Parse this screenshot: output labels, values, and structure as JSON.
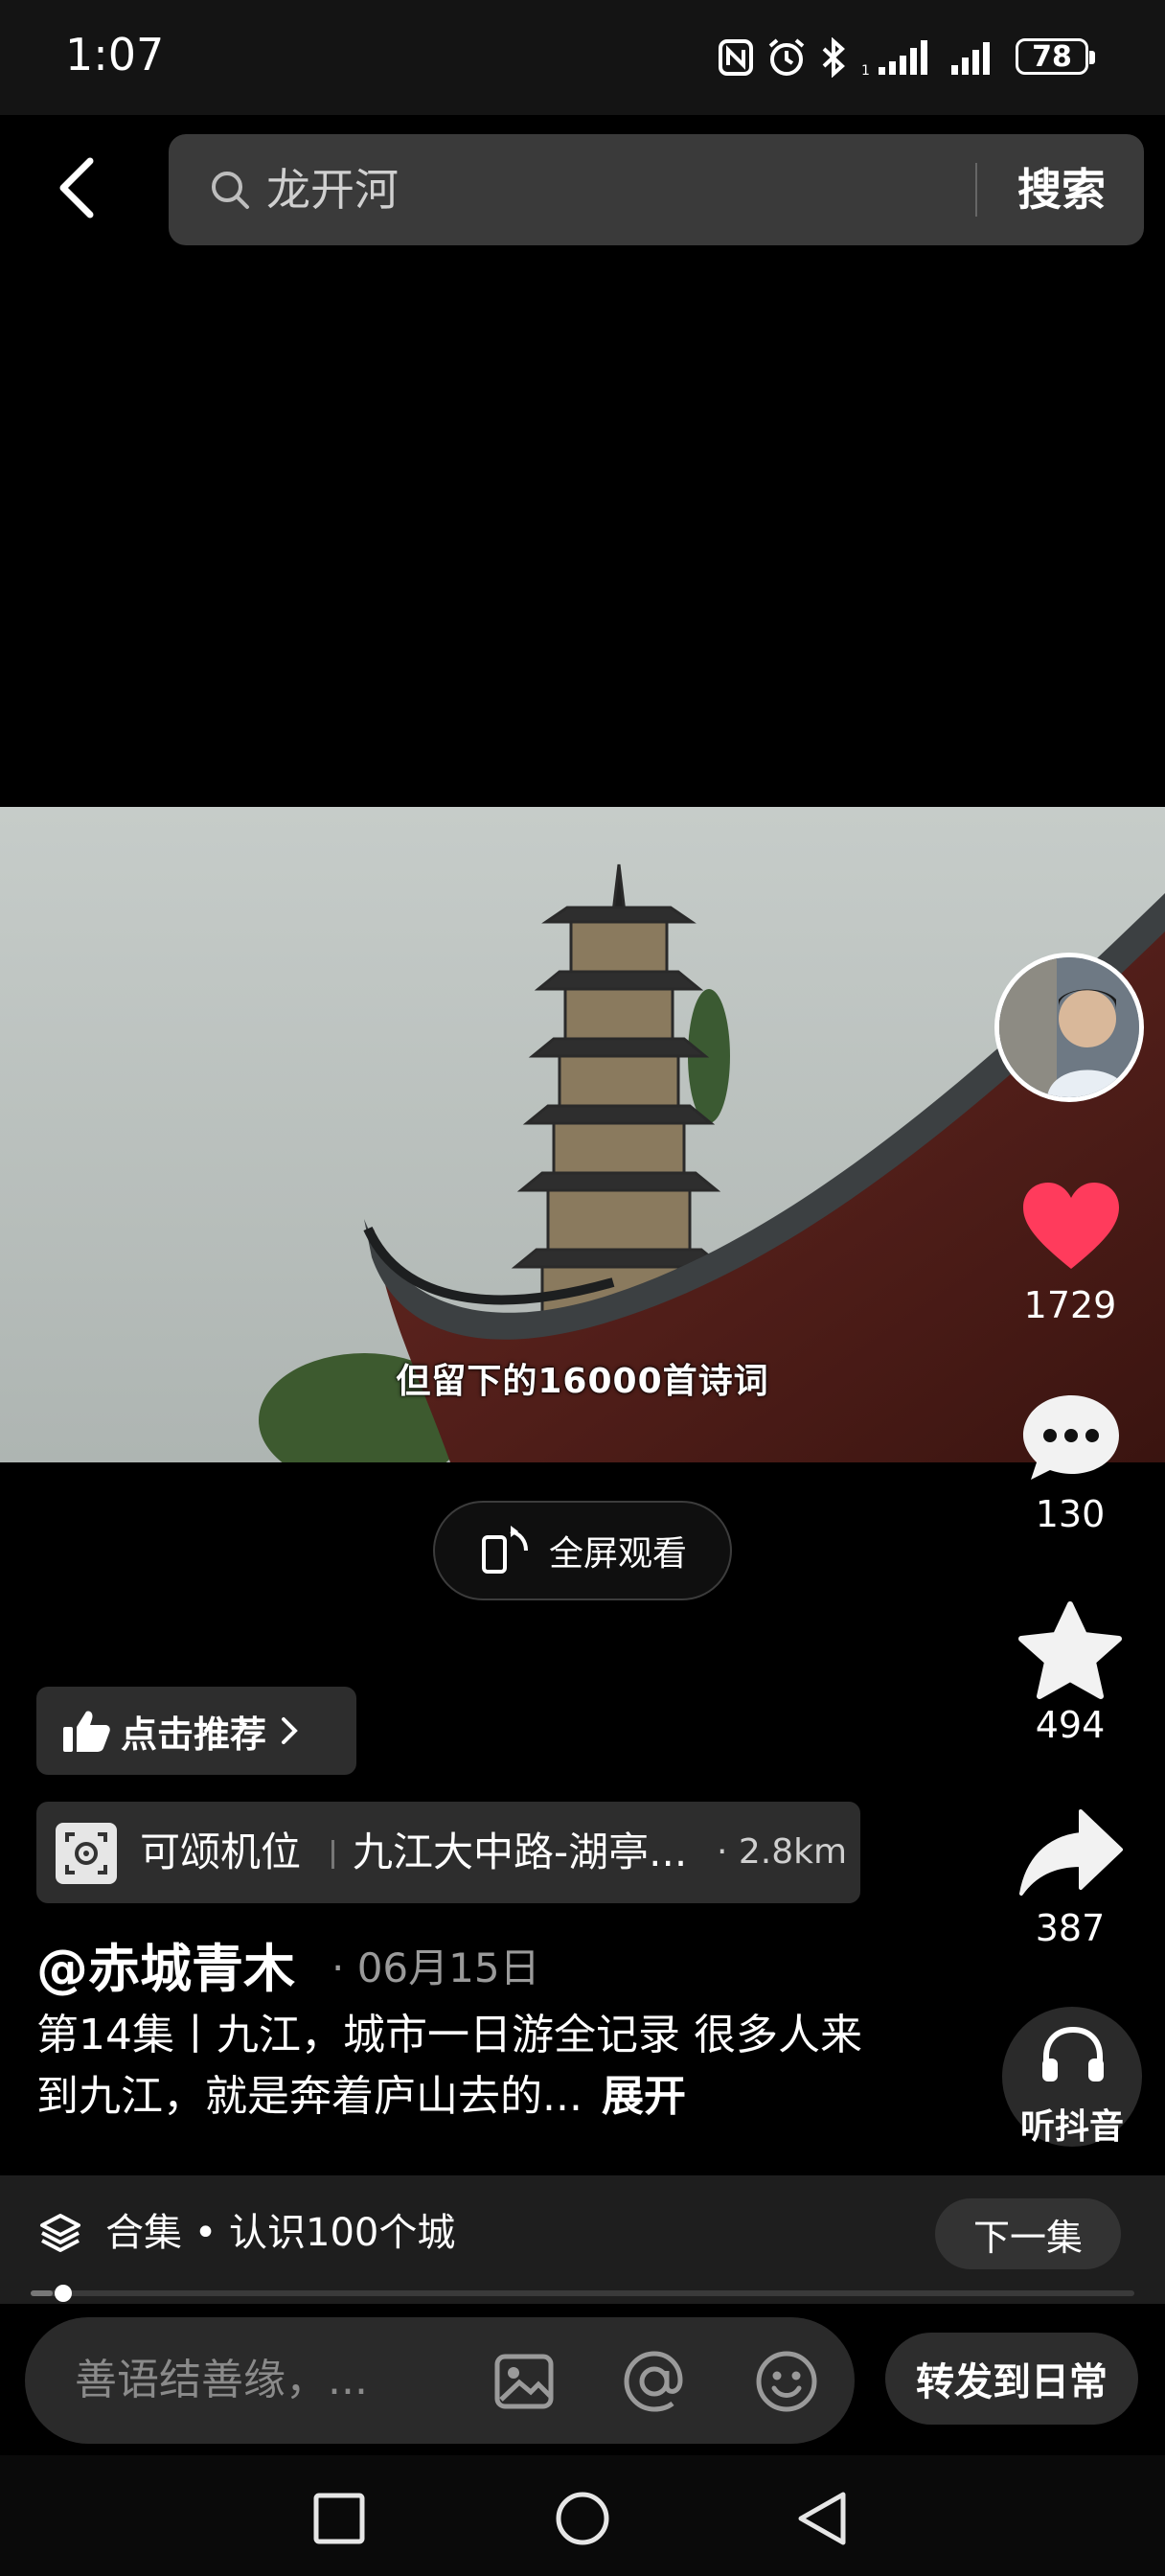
{
  "status_bar": {
    "time": "1:07",
    "battery": "78",
    "icons": [
      "nfc-icon",
      "alarm-icon",
      "bluetooth-icon",
      "signal-icon",
      "signal-icon",
      "battery-icon"
    ]
  },
  "header": {
    "back_icon": "back-arrow-icon",
    "search_icon": "search-icon",
    "search_value": "龙开河",
    "search_button": "搜索"
  },
  "video": {
    "subtitle": "但留下的16000首诗词",
    "fullscreen_label": "全屏观看"
  },
  "sidebar": {
    "like_count": "1729",
    "comment_count": "130",
    "favorite_count": "494",
    "share_count": "387",
    "listen_label": "听抖音",
    "colors": {
      "like": "#ff3b5c"
    }
  },
  "info": {
    "recommend_label": "点击推荐",
    "location_label": "可颂机位",
    "location_place": "九江大中路-湖亭...",
    "location_distance": "· 2.8km",
    "author": "@赤城青木",
    "date": "· 06月15日",
    "description": "第14集丨九江，城市一日游全记录 很多人来到九江，就是奔着庐山去的...",
    "expand_label": "展开"
  },
  "collection": {
    "label": "合集 • 认识100个城",
    "next_label": "下一集",
    "progress": 0.02
  },
  "comment_bar": {
    "placeholder": "善语结善缘，...",
    "forward_label": "转发到日常"
  }
}
